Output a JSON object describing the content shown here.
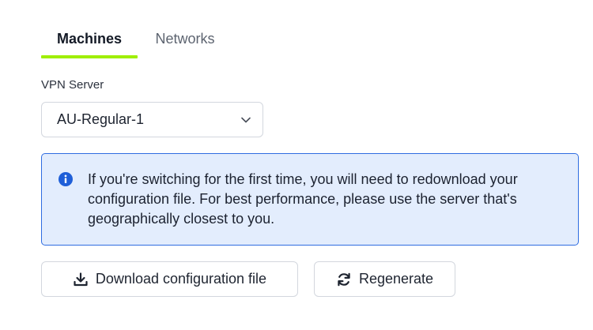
{
  "tabs": [
    {
      "label": "Machines",
      "active": true
    },
    {
      "label": "Networks",
      "active": false
    }
  ],
  "vpn_server": {
    "label": "VPN Server",
    "selected": "AU-Regular-1"
  },
  "alert": {
    "icon": "info-icon",
    "message": "If you're switching for the first time, you will need to redownload your configuration file. For best performance, please use the server that's geographically closest to you."
  },
  "actions": {
    "download_label": "Download configuration file",
    "download_icon": "download-icon",
    "regenerate_label": "Regenerate",
    "regenerate_icon": "refresh-icon"
  },
  "colors": {
    "accent": "#9fef00",
    "alert_border": "#2f6de1",
    "alert_background": "#e3edfd"
  }
}
